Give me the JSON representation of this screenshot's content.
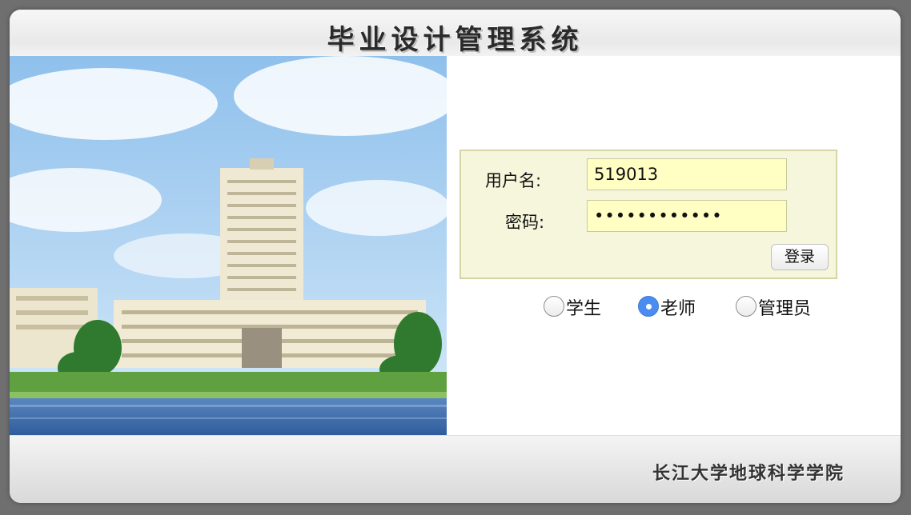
{
  "header": {
    "title": "毕业设计管理系统"
  },
  "login": {
    "username_label": "用户名:",
    "username_value": "519013",
    "password_label": "密码:",
    "password_value": "••••••••••••",
    "submit_label": "登录"
  },
  "roles": [
    {
      "label": "学生",
      "checked": false
    },
    {
      "label": "老师",
      "checked": true
    },
    {
      "label": "管理员",
      "checked": false
    }
  ],
  "footer": {
    "college": "长江大学地球科学学院"
  },
  "colors": {
    "input_bg": "#ffffc4",
    "login_box_bg": "#f6f6dc",
    "radio_checked": "#4a8cf0"
  }
}
